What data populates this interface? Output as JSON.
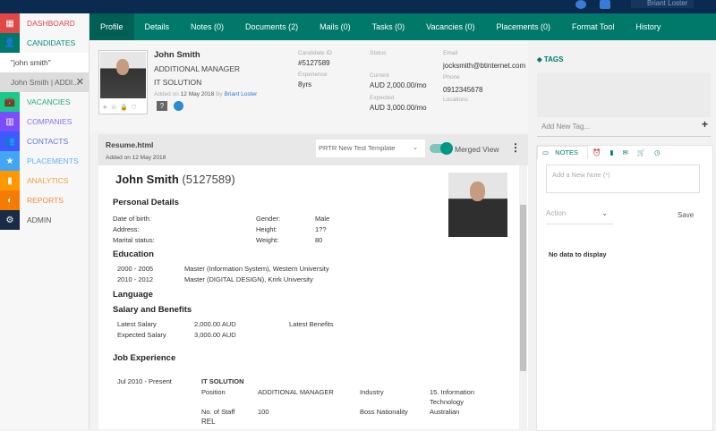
{
  "topbar": {
    "user": "Briant Loster"
  },
  "sidebar": {
    "items": [
      {
        "label": "DASHBOARD",
        "color": "#e04848",
        "text": "#e04848",
        "icon": "▦"
      },
      {
        "label": "CANDIDATES",
        "color": "#00796b",
        "text": "#00897b",
        "icon": "👤"
      },
      {
        "label": "VACANCIES",
        "color": "#1cc88a",
        "text": "#1cb079",
        "icon": "💼"
      },
      {
        "label": "COMPANIES",
        "color": "#7c4dff",
        "text": "#8a6cf0",
        "icon": "▥"
      },
      {
        "label": "CONTACTS",
        "color": "#3d5afe",
        "text": "#5c74e8",
        "icon": "👥"
      },
      {
        "label": "PLACEMENTS",
        "color": "#42a5f5",
        "text": "#5fb0f0",
        "icon": "★"
      },
      {
        "label": "ANALYTICS",
        "color": "#ff9800",
        "text": "#f0a040",
        "icon": "▮"
      },
      {
        "label": "REPORTS",
        "color": "#f57c00",
        "text": "#f08a40",
        "icon": "◐"
      },
      {
        "label": "ADMIN",
        "color": "#1a2c45",
        "text": "#555",
        "icon": "⚙"
      }
    ],
    "search": "\"john smith\"",
    "open_record": "John Smith | ADDI..."
  },
  "tabs": [
    "Profile",
    "Details",
    "Notes (0)",
    "Documents (2)",
    "Mails (0)",
    "Tasks (0)",
    "Vacancies (0)",
    "Placements (0)",
    "Format Tool",
    "History"
  ],
  "profile": {
    "name": "John Smith",
    "title": "ADDITIONAL MANAGER",
    "company": "IT SOLUTION",
    "added_prefix": "Added on",
    "added_date": "12 May 2018",
    "by": "By",
    "added_by": "Briant Loster",
    "candidate_id_label": "Candidate ID",
    "candidate_id": "#5127589",
    "experience_label": "Experience",
    "experience": "8yrs",
    "status_label": "Status",
    "current_label": "Current",
    "current": "AUD 2,000.00/mo",
    "expected_label": "Expected",
    "expected": "AUD 3,000.00/mo",
    "email_label": "Email",
    "email": "jocksmith@btinternet.com",
    "phone_label": "Phone",
    "phone": "0912345678",
    "locations_label": "Locations"
  },
  "resume": {
    "file": "Resume.html",
    "added": "Added on 12 May 2018",
    "template": "PRTR New Test Template",
    "merged_view": "Merged View",
    "merged_on": true,
    "name": "John Smith",
    "id": "(5127589)",
    "personal_heading": "Personal Details",
    "personal": [
      [
        "Date of birth:",
        "",
        "Gender:",
        "Male"
      ],
      [
        "Address:",
        "",
        "Height:",
        "1??"
      ],
      [
        "Marital status:",
        "",
        "Weight:",
        "80"
      ]
    ],
    "education_heading": "Education",
    "education": [
      [
        "2000 - 2005",
        "Master (Information System), Western University"
      ],
      [
        "2010 - 2012",
        "Master (DIGITAL DESIGN), Krirk University"
      ]
    ],
    "language_heading": "Language",
    "salary_heading": "Salary and Benefits",
    "latest_salary_label": "Latest Salary",
    "latest_salary": "2,000.00 AUD",
    "latest_benefits_label": "Latest Benefits",
    "expected_salary_label": "Expected Salary",
    "expected_salary": "3,000.00 AUD",
    "job_heading": "Job Experience",
    "job": {
      "period": "Jul 2010 - Present",
      "company": "IT SOLUTION",
      "position_label": "Position",
      "position": "ADDITIONAL MANAGER",
      "industry_label": "Industry",
      "industry": "15. Information Technology",
      "staff_label": "No. of Staff",
      "staff": "100",
      "boss_label": "Boss Nationality",
      "boss": "Australian",
      "ref_label": "REL"
    }
  },
  "right": {
    "tags_title": "TAGS",
    "add_tag": "Add New Tag...",
    "notes_tab": "NOTES",
    "note_placeholder": "Add a New Note (*)",
    "action": "Action",
    "save": "Save",
    "no_data": "No data to display"
  }
}
